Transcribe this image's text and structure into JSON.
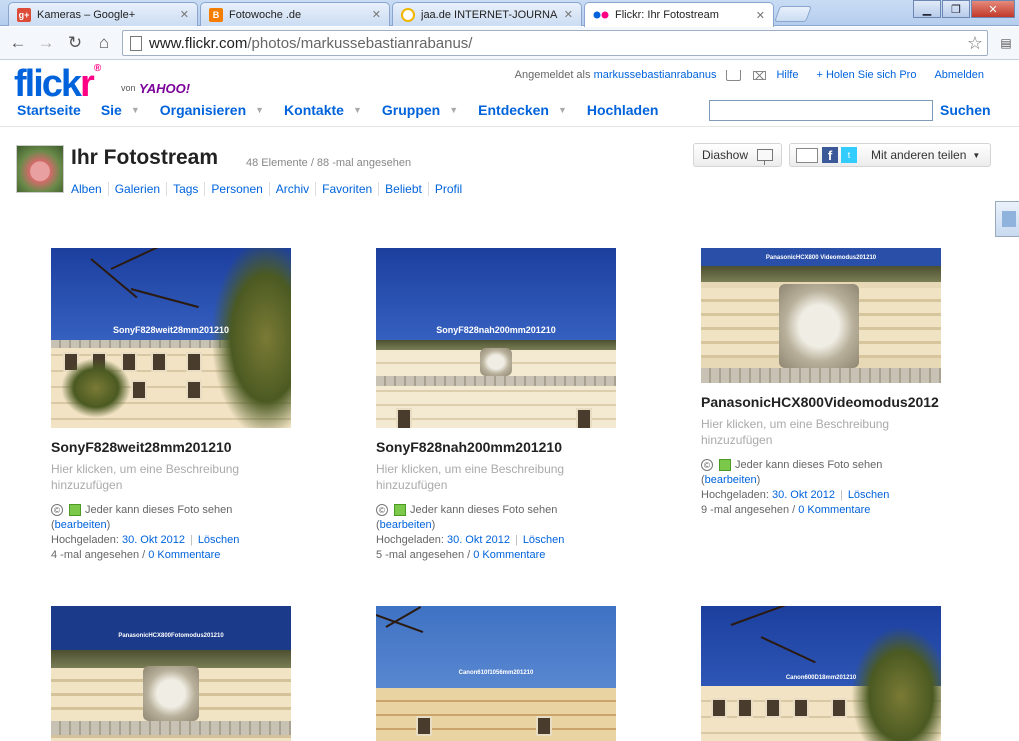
{
  "browser": {
    "tabs": [
      {
        "title": "Kameras – Google+",
        "fav": "g+",
        "color": "#dd4b39"
      },
      {
        "title": "Fotowoche .de",
        "fav": "B",
        "color": "#f57d00"
      },
      {
        "title": "jaa.de INTERNET-JOURNAL",
        "fav": "j",
        "color": "#ffcc00"
      },
      {
        "title": "Flickr: Ihr Fotostream",
        "fav": "flickr",
        "color": "#ff0084"
      }
    ],
    "url_host": "www.flickr.com",
    "url_path": "/photos/markussebastianrabanus/"
  },
  "flickr": {
    "logo_part1": "flick",
    "logo_part2": "r",
    "logo_reg": "®",
    "von": "von",
    "yahoo": "YAHOO!",
    "signed_in_prefix": "Angemeldet als",
    "username": "markussebastianrabanus",
    "help": "Hilfe",
    "pro": "+ Holen Sie sich Pro",
    "logout": "Abmelden",
    "nav": [
      "Startseite",
      "Sie",
      "Organisieren",
      "Kontakte",
      "Gruppen",
      "Entdecken",
      "Hochladen"
    ],
    "search_button": "Suchen",
    "search_value": ""
  },
  "stream": {
    "title": "Ihr Fotostream",
    "meta": "48 Elemente / 88 -mal angesehen",
    "subnav": [
      "Alben",
      "Galerien",
      "Tags",
      "Personen",
      "Archiv",
      "Favoriten",
      "Beliebt",
      "Profil"
    ],
    "slideshow": "Diashow",
    "share": "Mit anderen teilen"
  },
  "photos": [
    {
      "title": "SonyF828weit28mm201210",
      "label": "SonyF828weit28mm201210",
      "desc": "Hier klicken, um eine Beschreibung hinzuzufügen",
      "privacy": "Jeder kann dieses Foto sehen",
      "edit": "bearbeiten",
      "uploaded_label": "Hochgeladen:",
      "date": "30. Okt 2012",
      "delete": "Löschen",
      "views": "4 -mal angesehen",
      "comments": "0 Kommentare"
    },
    {
      "title": "SonyF828nah200mm201210",
      "label": "SonyF828nah200mm201210",
      "desc": "Hier klicken, um eine Beschreibung hinzuzufügen",
      "privacy": "Jeder kann dieses Foto sehen",
      "edit": "bearbeiten",
      "uploaded_label": "Hochgeladen:",
      "date": "30. Okt 2012",
      "delete": "Löschen",
      "views": "5 -mal angesehen",
      "comments": "0 Kommentare"
    },
    {
      "title": "PanasonicHCX800Videomodus2012",
      "label": "PanasonicHCX800 Videomodus201210",
      "desc": "Hier klicken, um eine Beschreibung hinzuzufügen",
      "privacy": "Jeder kann dieses Foto sehen",
      "edit": "bearbeiten",
      "uploaded_label": "Hochgeladen:",
      "date": "30. Okt 2012",
      "delete": "Löschen",
      "views": "9 -mal angesehen",
      "comments": "0 Kommentare"
    },
    {
      "label": "PanasonicHCX800Fotomodus201210"
    },
    {
      "label": "Canon610f1056mm201210"
    },
    {
      "label": "Canon600D18mm201210"
    }
  ]
}
